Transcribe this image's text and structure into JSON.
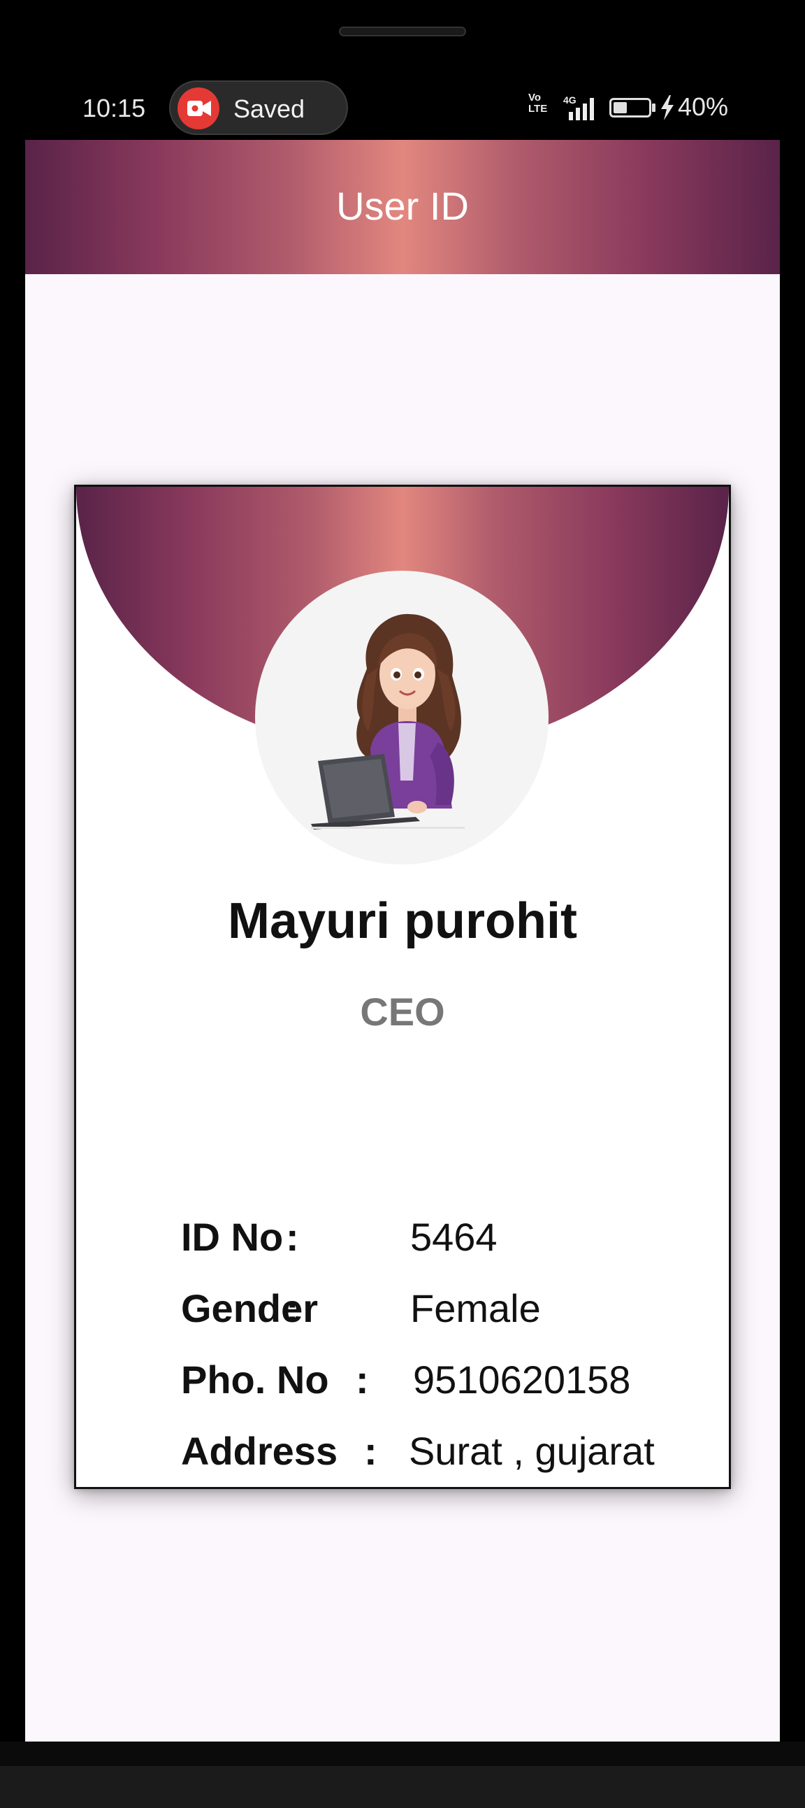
{
  "status_bar": {
    "time": "10:15",
    "recording_label": "Saved",
    "network_tag": "Vo LTE",
    "network_type": "4G",
    "battery_percent": "40%",
    "battery_level": 0.4
  },
  "app_bar": {
    "title": "User ID"
  },
  "profile": {
    "name": "Mayuri purohit",
    "role": "CEO",
    "fields": [
      {
        "label": "ID No",
        "colon": ":",
        "value": "5464"
      },
      {
        "label": "Gender",
        "colon": ":",
        "value": "Female"
      },
      {
        "label": "Pho. No",
        "colon": ":",
        "value": "9510620158"
      },
      {
        "label": "Address",
        "colon": ":",
        "value": "Surat , gujarat"
      }
    ]
  },
  "colors": {
    "gradient_dark": "#5a2349",
    "gradient_light": "#e2877f",
    "screen_bg": "#fcf6fd",
    "role_text": "#777777"
  }
}
